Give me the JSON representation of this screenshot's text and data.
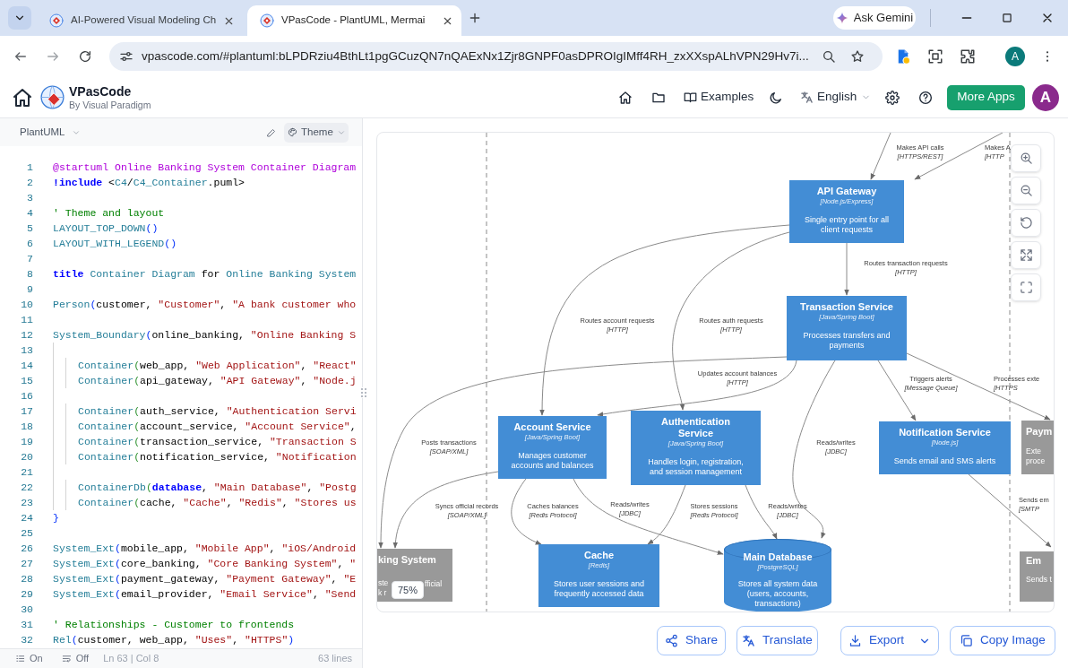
{
  "browser": {
    "tabs": [
      {
        "title": "AI-Powered Visual Modeling Ch",
        "selected": false
      },
      {
        "title": "VPasCode - PlantUML, Mermai",
        "selected": true
      }
    ],
    "gemini_button": "Ask Gemini",
    "address": "vpascode.com/#plantuml:bLPDRziu4BthLt1pgGCuzQN7nQAExNx1Zjr8GNPF0asDPROIgIMff4RH_zxXXspALhVPN29Hv7i...",
    "profile_initial": "A"
  },
  "header": {
    "app_name": "VPasCode",
    "byline": "By Visual Paradigm",
    "examples_link": "Examples",
    "language": "English",
    "more_apps_button": "More Apps",
    "avatar_initial": "A"
  },
  "editor": {
    "syntax": "PlantUML",
    "theme_button": "Theme",
    "lines": [
      {
        "number": "1",
        "tokens": [
          {
            "kind": "directive",
            "text": "@startuml Online Banking System Container Diagram"
          }
        ]
      },
      {
        "number": "2",
        "tokens": [
          {
            "kind": "keyword",
            "text": "!include"
          },
          {
            "kind": "text",
            "text": " <"
          },
          {
            "kind": "macro",
            "text": "C4"
          },
          {
            "kind": "text",
            "text": "/"
          },
          {
            "kind": "macro",
            "text": "C4_Container"
          },
          {
            "kind": "text",
            "text": ".puml>"
          }
        ]
      },
      {
        "number": "3"
      },
      {
        "number": "4",
        "tokens": [
          {
            "kind": "comment",
            "text": "' Theme and layout"
          }
        ]
      },
      {
        "number": "5",
        "tokens": [
          {
            "kind": "macro",
            "text": "LAYOUT_TOP_DOWN"
          },
          {
            "kind": "bracket",
            "text": "()"
          }
        ]
      },
      {
        "number": "6",
        "tokens": [
          {
            "kind": "macro",
            "text": "LAYOUT_WITH_LEGEND"
          },
          {
            "kind": "bracket",
            "text": "()"
          }
        ]
      },
      {
        "number": "7"
      },
      {
        "number": "8",
        "tokens": [
          {
            "kind": "keyword",
            "text": "title"
          },
          {
            "kind": "macro",
            "text": " Container Diagram"
          },
          {
            "kind": "text",
            "text": " for "
          },
          {
            "kind": "macro",
            "text": "Online Banking System"
          }
        ]
      },
      {
        "number": "9"
      },
      {
        "number": "10",
        "tokens": [
          {
            "kind": "macro",
            "text": "Person"
          },
          {
            "kind": "bracket",
            "text": "("
          },
          {
            "kind": "text",
            "text": "customer, "
          },
          {
            "kind": "string",
            "text": "\"Customer\""
          },
          {
            "kind": "text",
            "text": ", "
          },
          {
            "kind": "string",
            "text": "\"A bank customer who"
          }
        ]
      },
      {
        "number": "11"
      },
      {
        "number": "12",
        "tokens": [
          {
            "kind": "macro",
            "text": "System_Boundary"
          },
          {
            "kind": "bracket",
            "text": "("
          },
          {
            "kind": "text",
            "text": "online_banking, "
          },
          {
            "kind": "string",
            "text": "\"Online Banking S"
          }
        ],
        "children": [
          {
            "number": "13"
          },
          {
            "number": "14",
            "tokens": [
              {
                "kind": "macro",
                "text": "Container"
              },
              {
                "kind": "bracket",
                "text": "("
              },
              {
                "kind": "text",
                "text": "web_app, "
              },
              {
                "kind": "string",
                "text": "\"Web Application\""
              },
              {
                "kind": "text",
                "text": ", "
              },
              {
                "kind": "string",
                "text": "\"React\""
              }
            ]
          },
          {
            "number": "15",
            "tokens": [
              {
                "kind": "macro",
                "text": "Container"
              },
              {
                "kind": "bracket",
                "text": "("
              },
              {
                "kind": "text",
                "text": "api_gateway, "
              },
              {
                "kind": "string",
                "text": "\"API Gateway\""
              },
              {
                "kind": "text",
                "text": ", "
              },
              {
                "kind": "string",
                "text": "\"Node.j"
              }
            ]
          },
          {
            "number": "16"
          },
          {
            "number": "17",
            "tokens": [
              {
                "kind": "macro",
                "text": "Container"
              },
              {
                "kind": "bracket",
                "text": "("
              },
              {
                "kind": "text",
                "text": "auth_service, "
              },
              {
                "kind": "string",
                "text": "\"Authentication Servi"
              }
            ]
          },
          {
            "number": "18",
            "tokens": [
              {
                "kind": "macro",
                "text": "Container"
              },
              {
                "kind": "bracket",
                "text": "("
              },
              {
                "kind": "text",
                "text": "account_service, "
              },
              {
                "kind": "string",
                "text": "\"Account Service\""
              },
              {
                "kind": "text",
                "text": ","
              }
            ]
          },
          {
            "number": "19",
            "tokens": [
              {
                "kind": "macro",
                "text": "Container"
              },
              {
                "kind": "bracket",
                "text": "("
              },
              {
                "kind": "text",
                "text": "transaction_service, "
              },
              {
                "kind": "string",
                "text": "\"Transaction S"
              }
            ]
          },
          {
            "number": "20",
            "tokens": [
              {
                "kind": "macro",
                "text": "Container"
              },
              {
                "kind": "bracket",
                "text": "("
              },
              {
                "kind": "text",
                "text": "notification_service, "
              },
              {
                "kind": "string",
                "text": "\"Notification"
              }
            ]
          },
          {
            "number": "21"
          },
          {
            "number": "22",
            "tokens": [
              {
                "kind": "macro",
                "text": "ContainerDb"
              },
              {
                "kind": "bracket",
                "text": "("
              },
              {
                "kind": "keyword",
                "text": "database"
              },
              {
                "kind": "text",
                "text": ", "
              },
              {
                "kind": "string",
                "text": "\"Main Database\""
              },
              {
                "kind": "text",
                "text": ", "
              },
              {
                "kind": "string",
                "text": "\"Postg"
              }
            ]
          },
          {
            "number": "23",
            "tokens": [
              {
                "kind": "macro",
                "text": "Container"
              },
              {
                "kind": "bracket",
                "text": "("
              },
              {
                "kind": "text",
                "text": "cache, "
              },
              {
                "kind": "string",
                "text": "\"Cache\""
              },
              {
                "kind": "text",
                "text": ", "
              },
              {
                "kind": "string",
                "text": "\"Redis\""
              },
              {
                "kind": "text",
                "text": ", "
              },
              {
                "kind": "string",
                "text": "\"Stores us"
              }
            ]
          }
        ]
      },
      {
        "number": "24",
        "tokens": [
          {
            "kind": "bracket",
            "text": "}"
          }
        ]
      },
      {
        "number": "25"
      },
      {
        "number": "26",
        "tokens": [
          {
            "kind": "macro",
            "text": "System_Ext"
          },
          {
            "kind": "bracket",
            "text": "("
          },
          {
            "kind": "text",
            "text": "mobile_app, "
          },
          {
            "kind": "string",
            "text": "\"Mobile App\""
          },
          {
            "kind": "text",
            "text": ", "
          },
          {
            "kind": "string",
            "text": "\"iOS/Android"
          }
        ]
      },
      {
        "number": "27",
        "tokens": [
          {
            "kind": "macro",
            "text": "System_Ext"
          },
          {
            "kind": "bracket",
            "text": "("
          },
          {
            "kind": "text",
            "text": "core_banking, "
          },
          {
            "kind": "string",
            "text": "\"Core Banking System\""
          },
          {
            "kind": "text",
            "text": ", "
          },
          {
            "kind": "string",
            "text": "\""
          }
        ]
      },
      {
        "number": "28",
        "tokens": [
          {
            "kind": "macro",
            "text": "System_Ext"
          },
          {
            "kind": "bracket",
            "text": "("
          },
          {
            "kind": "text",
            "text": "payment_gateway, "
          },
          {
            "kind": "string",
            "text": "\"Payment Gateway\""
          },
          {
            "kind": "text",
            "text": ", "
          },
          {
            "kind": "string",
            "text": "\"E"
          }
        ]
      },
      {
        "number": "29",
        "tokens": [
          {
            "kind": "macro",
            "text": "System_Ext"
          },
          {
            "kind": "bracket",
            "text": "("
          },
          {
            "kind": "text",
            "text": "email_provider, "
          },
          {
            "kind": "string",
            "text": "\"Email Service\""
          },
          {
            "kind": "text",
            "text": ", "
          },
          {
            "kind": "string",
            "text": "\"Send"
          }
        ]
      },
      {
        "number": "30"
      },
      {
        "number": "31",
        "tokens": [
          {
            "kind": "comment",
            "text": "' Relationships - Customer to frontends"
          }
        ]
      },
      {
        "number": "32",
        "tokens": [
          {
            "kind": "macro",
            "text": "Rel"
          },
          {
            "kind": "bracket",
            "text": "("
          },
          {
            "kind": "text",
            "text": "customer, web_app, "
          },
          {
            "kind": "string",
            "text": "\"Uses\""
          },
          {
            "kind": "text",
            "text": ", "
          },
          {
            "kind": "string",
            "text": "\"HTTPS\""
          },
          {
            "kind": "bracket",
            "text": ")"
          }
        ]
      }
    ],
    "status_bar": {
      "toggles": [
        {
          "kind": "list",
          "label": "On"
        },
        {
          "kind": "wrap",
          "label": "Off"
        }
      ],
      "cursor": "Ln 63 | Col 8",
      "line_count": "63 lines"
    }
  },
  "diagram": {
    "zoom_level": "75%",
    "nodes": [
      {
        "kind": "container",
        "title": "API Gateway",
        "technology": "[Node.js/Express]",
        "description_lines": [
          "Single entry point for all",
          "client requests"
        ]
      },
      {
        "kind": "container",
        "title": "Transaction Service",
        "technology": "[Java/Spring Boot]",
        "description_lines": [
          "Processes transfers and",
          "payments"
        ]
      },
      {
        "kind": "container",
        "title": "Account Service",
        "technology": "[Java/Spring Boot]",
        "description_lines": [
          "Manages customer",
          "accounts and balances"
        ]
      },
      {
        "kind": "container",
        "title": "Authentication Service",
        "technology": "[Java/Spring Boot]",
        "description_lines": [
          "Handles login, registration,",
          "and session management"
        ]
      },
      {
        "kind": "container",
        "title": "Notification Service",
        "technology": "[Node.js]",
        "description_lines": [
          "Sends email and SMS alerts"
        ]
      },
      {
        "kind": "external",
        "title": "Paym",
        "description_lines": [
          "Exte",
          "proce"
        ]
      },
      {
        "kind": "external",
        "title": "king System",
        "description_lines": [
          "ste",
          "k r"
        ],
        "description_after_badge": "fficial"
      },
      {
        "kind": "container",
        "title": "Cache",
        "technology": "[Redis]",
        "description_lines": [
          "Stores user sessions and",
          "frequently accessed data"
        ]
      },
      {
        "kind": "database",
        "title": "Main Database",
        "technology": "[PostgreSQL]",
        "description_lines": [
          "Stores all system data",
          "(users, accounts,",
          "transactions)"
        ]
      },
      {
        "kind": "external",
        "title": "Em",
        "description_lines": [
          "Sends t"
        ]
      }
    ],
    "relationships": [
      {
        "label": "Makes API calls",
        "technology": "[HTTPS/REST]"
      },
      {
        "label": "Makes A",
        "technology": "[HTTP"
      },
      {
        "label": "Routes transaction requests",
        "technology": "[HTTP]"
      },
      {
        "label": "Routes account requests",
        "technology": "[HTTP]"
      },
      {
        "label": "Routes auth requests",
        "technology": "[HTTP]"
      },
      {
        "label": "Updates account balances",
        "technology": "[HTTP]"
      },
      {
        "label": "Triggers alerts",
        "technology": "[Message Queue]"
      },
      {
        "label": "Processes exte",
        "technology": "[HTTPS"
      },
      {
        "label": "Posts transactions",
        "technology": "[SOAP/XML]"
      },
      {
        "label": "Reads/writes",
        "technology": "[JDBC]"
      },
      {
        "label": "Syncs official records",
        "technology": "[SOAP/XML]"
      },
      {
        "label": "Caches balances",
        "technology": "[Redis Protocol]"
      },
      {
        "label": "Reads/writes",
        "technology": "[JDBC]"
      },
      {
        "label": "Stores sessions",
        "technology": "[Redis Protocol]"
      },
      {
        "label": "Reads/writes",
        "technology": "[JDBC]"
      },
      {
        "label": "Sends em",
        "technology": "[SMTP"
      }
    ]
  },
  "actions": [
    {
      "kind": "share",
      "label": "Share"
    },
    {
      "kind": "translate",
      "label": "Translate"
    },
    {
      "kind": "export",
      "label": "Export"
    },
    {
      "kind": "copy",
      "label": "Copy Image"
    }
  ]
}
